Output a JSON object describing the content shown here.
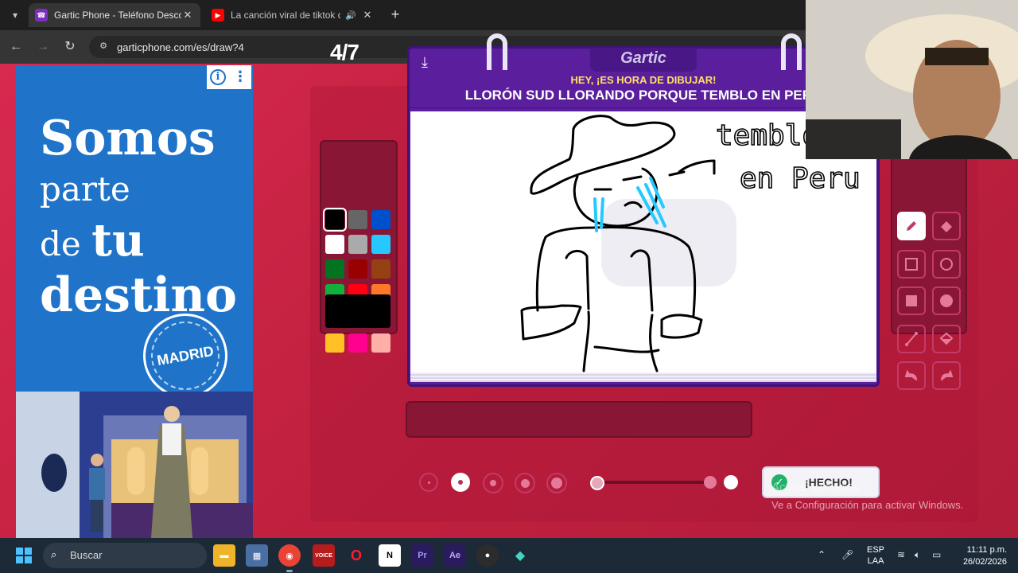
{
  "browser": {
    "tabs": [
      {
        "title": "Gartic Phone - Teléfono Descon",
        "active": true
      },
      {
        "title": "La canción viral de tiktok qu",
        "active": false
      }
    ],
    "url": "garticphone.com/es/draw?4"
  },
  "ad": {
    "line1": "Somos",
    "line2": "parte",
    "line3_a": "de ",
    "line3_b": "tu",
    "line4": "destino",
    "seal": "MADRID"
  },
  "game": {
    "round": "4/7",
    "logo": "Gartic",
    "prompt_sub": "HEY, ¡ES HORA DE DIBUJAR!",
    "prompt": "LLORÓN SUD LLORANDO PORQUE TEMBLO EN PERÚ",
    "done_label": "¡HECHO!",
    "canvas_text_1": "temblo",
    "canvas_text_2": "en Peru",
    "palette": [
      "#000000",
      "#666666",
      "#0050cd",
      "#ffffff",
      "#aaaaaa",
      "#26c9ff",
      "#017420",
      "#990000",
      "#964112",
      "#11b03c",
      "#ff0013",
      "#ff7829",
      "#b0701c",
      "#99004e",
      "#cb5a57",
      "#ffc126",
      "#ff008f",
      "#feafa8"
    ],
    "selected_color": "#000000",
    "brush_size_selected": 2,
    "opacity": 1.0
  },
  "windows": {
    "watermark_title": "Activar Windows",
    "watermark_sub": "Ve a Configuración para activar Windows.",
    "search": "Buscar",
    "lang1": "ESP",
    "lang2": "LAA",
    "time": "11:11 p.m.",
    "date": "26/02/2026"
  }
}
